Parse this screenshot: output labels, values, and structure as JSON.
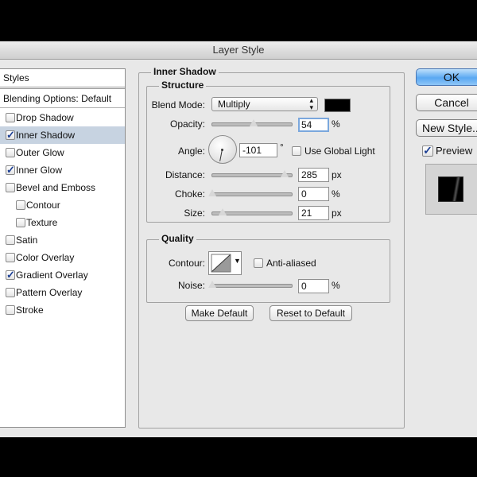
{
  "window": {
    "title": "Layer Style"
  },
  "styles_panel": {
    "header": "Styles",
    "blending_options": "Blending Options: Default",
    "items": [
      {
        "label": "Drop Shadow",
        "checked": false,
        "selected": false,
        "indent": false
      },
      {
        "label": "Inner Shadow",
        "checked": true,
        "selected": true,
        "indent": false
      },
      {
        "label": "Outer Glow",
        "checked": false,
        "selected": false,
        "indent": false
      },
      {
        "label": "Inner Glow",
        "checked": true,
        "selected": false,
        "indent": false
      },
      {
        "label": "Bevel and Emboss",
        "checked": false,
        "selected": false,
        "indent": false
      },
      {
        "label": "Contour",
        "checked": false,
        "selected": false,
        "indent": true
      },
      {
        "label": "Texture",
        "checked": false,
        "selected": false,
        "indent": true
      },
      {
        "label": "Satin",
        "checked": false,
        "selected": false,
        "indent": false
      },
      {
        "label": "Color Overlay",
        "checked": false,
        "selected": false,
        "indent": false
      },
      {
        "label": "Gradient Overlay",
        "checked": true,
        "selected": false,
        "indent": false
      },
      {
        "label": "Pattern Overlay",
        "checked": false,
        "selected": false,
        "indent": false
      },
      {
        "label": "Stroke",
        "checked": false,
        "selected": false,
        "indent": false
      }
    ]
  },
  "inner_shadow": {
    "title": "Inner Shadow",
    "structure": {
      "title": "Structure",
      "blend_mode_label": "Blend Mode:",
      "blend_mode_value": "Multiply",
      "shadow_color": "#000000",
      "opacity_label": "Opacity:",
      "opacity_value": "54",
      "opacity_unit": "%",
      "opacity_level": 0.54,
      "angle_label": "Angle:",
      "angle_value": "-101",
      "angle_unit": "°",
      "use_global_light_label": "Use Global Light",
      "use_global_light_checked": false,
      "distance_label": "Distance:",
      "distance_value": "285",
      "distance_unit": "px",
      "distance_level": 0.95,
      "choke_label": "Choke:",
      "choke_value": "0",
      "choke_unit": "%",
      "choke_level": 0,
      "size_label": "Size:",
      "size_value": "21",
      "size_unit": "px",
      "size_level": 0.14
    },
    "quality": {
      "title": "Quality",
      "contour_label": "Contour:",
      "anti_aliased_label": "Anti-aliased",
      "anti_aliased_checked": false,
      "noise_label": "Noise:",
      "noise_value": "0",
      "noise_unit": "%",
      "noise_level": 0
    },
    "make_default_label": "Make Default",
    "reset_default_label": "Reset to Default"
  },
  "actions": {
    "ok_label": "OK",
    "cancel_label": "Cancel",
    "new_style_label": "New Style...",
    "preview_label": "Preview",
    "preview_checked": true
  }
}
